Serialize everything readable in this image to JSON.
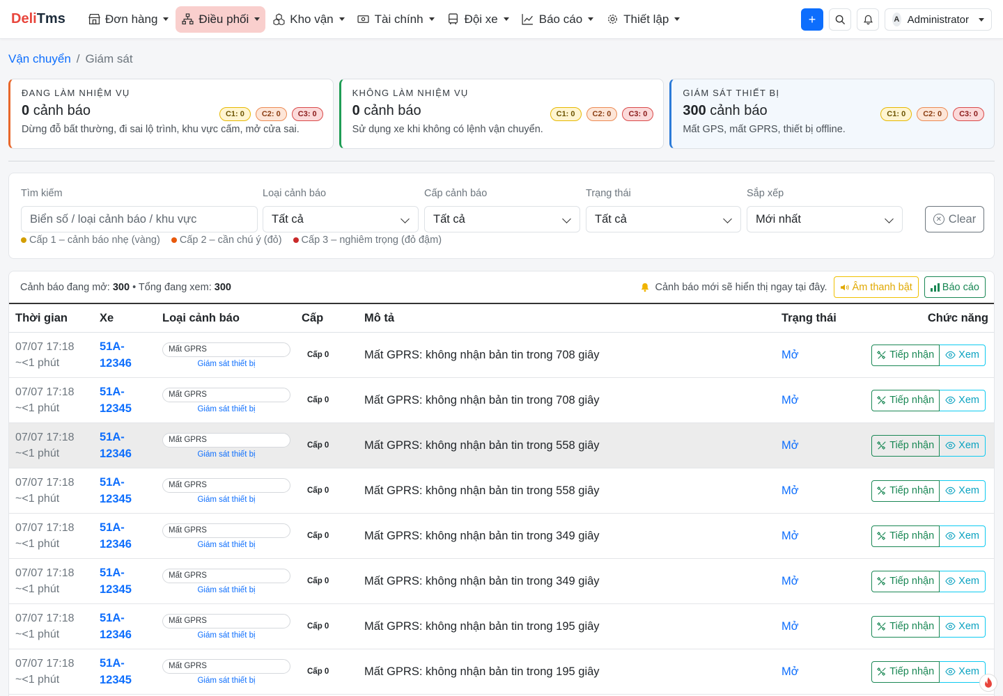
{
  "brand": {
    "part1": "Deli",
    "part2": "Tms"
  },
  "nav": [
    {
      "label": "Đơn hàng",
      "icon": "store-icon",
      "active": false
    },
    {
      "label": "Điều phối",
      "icon": "network-icon",
      "active": true
    },
    {
      "label": "Kho vận",
      "icon": "boxes-icon",
      "active": false
    },
    {
      "label": "Tài chính",
      "icon": "cash-icon",
      "active": false
    },
    {
      "label": "Đội xe",
      "icon": "bus-icon",
      "active": false
    },
    {
      "label": "Báo cáo",
      "icon": "chart-line-icon",
      "active": false
    },
    {
      "label": "Thiết lập",
      "icon": "gear-icon",
      "active": false
    }
  ],
  "user": {
    "initial": "A",
    "name": "Administrator"
  },
  "breadcrumb": {
    "parent": "Vận chuyển",
    "separator": "/",
    "current": "Giám sát"
  },
  "cards": [
    {
      "title": "Đang làm nhiệm vụ",
      "count": "0",
      "unit": "cảnh báo",
      "desc": "Dừng đỗ bất thường, đi sai lộ trình, khu vực cấm, mở cửa sai.",
      "c1": "C1: 0",
      "c2": "C2: 0",
      "c3": "C3: 0",
      "accent": "#e8672b"
    },
    {
      "title": "Không làm nhiệm vụ",
      "count": "0",
      "unit": "cảnh báo",
      "desc": "Sử dụng xe khi không có lệnh vận chuyển.",
      "c1": "C1: 0",
      "c2": "C2: 0",
      "c3": "C3: 0",
      "accent": "#1f9d55"
    },
    {
      "title": "Giám sát thiết bị",
      "count": "300",
      "unit": "cảnh báo",
      "desc": "Mất GPS, mất GPRS, thiết bị offline.",
      "c1": "C1: 0",
      "c2": "C2: 0",
      "c3": "C3: 0",
      "accent": "#2b7bd8"
    }
  ],
  "filters": {
    "search_label": "Tìm kiếm",
    "search_placeholder": "Biển số / loại cảnh báo / khu vực",
    "type_label": "Loại cảnh báo",
    "type_value": "Tất cả",
    "level_label": "Cấp cảnh báo",
    "level_value": "Tất cả",
    "status_label": "Trạng thái",
    "status_value": "Tất cả",
    "sort_label": "Sắp xếp",
    "sort_value": "Mới nhất",
    "clear_label": "Clear",
    "legend": [
      {
        "text": "Cấp 1 – cảnh báo nhẹ (vàng)",
        "color": "#d39e00"
      },
      {
        "text": "Cấp 2 – cần chú ý (đỏ)",
        "color": "#e8590c"
      },
      {
        "text": "Cấp 3 – nghiêm trọng (đỏ đậm)",
        "color": "#c92a2a"
      }
    ]
  },
  "table_bar": {
    "open_label": "Cảnh báo đang mở:",
    "open_count": "300",
    "total_label": "• Tổng đang xem:",
    "total_count": "300",
    "notice": "Cảnh báo mới sẽ hiển thị ngay tại đây.",
    "sound_label": "Âm thanh bật",
    "report_label": "Báo cáo"
  },
  "columns": [
    "Thời gian",
    "Xe",
    "Loại cảnh báo",
    "Cấp",
    "Mô tả",
    "Trạng thái",
    "Chức năng"
  ],
  "rows": [
    {
      "time": "07/07 17:18",
      "ago": "~<1 phút",
      "plate1": "51A-",
      "plate2": "12346",
      "type": "Mất GPRS",
      "group": "Giám sát thiết bị",
      "level": "Cấp 0",
      "desc": "Mất GPRS: không nhận bản tin trong 708 giây",
      "status": "Mở",
      "accept": "Tiếp nhận",
      "view": "Xem"
    },
    {
      "time": "07/07 17:18",
      "ago": "~<1 phút",
      "plate1": "51A-",
      "plate2": "12345",
      "type": "Mất GPRS",
      "group": "Giám sát thiết bị",
      "level": "Cấp 0",
      "desc": "Mất GPRS: không nhận bản tin trong 708 giây",
      "status": "Mở",
      "accept": "Tiếp nhận",
      "view": "Xem"
    },
    {
      "time": "07/07 17:18",
      "ago": "~<1 phút",
      "plate1": "51A-",
      "plate2": "12346",
      "type": "Mất GPRS",
      "group": "Giám sát thiết bị",
      "level": "Cấp 0",
      "desc": "Mất GPRS: không nhận bản tin trong 558 giây",
      "status": "Mở",
      "accept": "Tiếp nhận",
      "view": "Xem"
    },
    {
      "time": "07/07 17:18",
      "ago": "~<1 phút",
      "plate1": "51A-",
      "plate2": "12345",
      "type": "Mất GPRS",
      "group": "Giám sát thiết bị",
      "level": "Cấp 0",
      "desc": "Mất GPRS: không nhận bản tin trong 558 giây",
      "status": "Mở",
      "accept": "Tiếp nhận",
      "view": "Xem"
    },
    {
      "time": "07/07 17:18",
      "ago": "~<1 phút",
      "plate1": "51A-",
      "plate2": "12346",
      "type": "Mất GPRS",
      "group": "Giám sát thiết bị",
      "level": "Cấp 0",
      "desc": "Mất GPRS: không nhận bản tin trong 349 giây",
      "status": "Mở",
      "accept": "Tiếp nhận",
      "view": "Xem"
    },
    {
      "time": "07/07 17:18",
      "ago": "~<1 phút",
      "plate1": "51A-",
      "plate2": "12345",
      "type": "Mất GPRS",
      "group": "Giám sát thiết bị",
      "level": "Cấp 0",
      "desc": "Mất GPRS: không nhận bản tin trong 349 giây",
      "status": "Mở",
      "accept": "Tiếp nhận",
      "view": "Xem"
    },
    {
      "time": "07/07 17:18",
      "ago": "~<1 phút",
      "plate1": "51A-",
      "plate2": "12346",
      "type": "Mất GPRS",
      "group": "Giám sát thiết bị",
      "level": "Cấp 0",
      "desc": "Mất GPRS: không nhận bản tin trong 195 giây",
      "status": "Mở",
      "accept": "Tiếp nhận",
      "view": "Xem"
    },
    {
      "time": "07/07 17:18",
      "ago": "~<1 phút",
      "plate1": "51A-",
      "plate2": "12345",
      "type": "Mất GPRS",
      "group": "Giám sát thiết bị",
      "level": "Cấp 0",
      "desc": "Mất GPRS: không nhận bản tin trong 195 giây",
      "status": "Mở",
      "accept": "Tiếp nhận",
      "view": "Xem"
    }
  ],
  "highlighted_row": 2
}
